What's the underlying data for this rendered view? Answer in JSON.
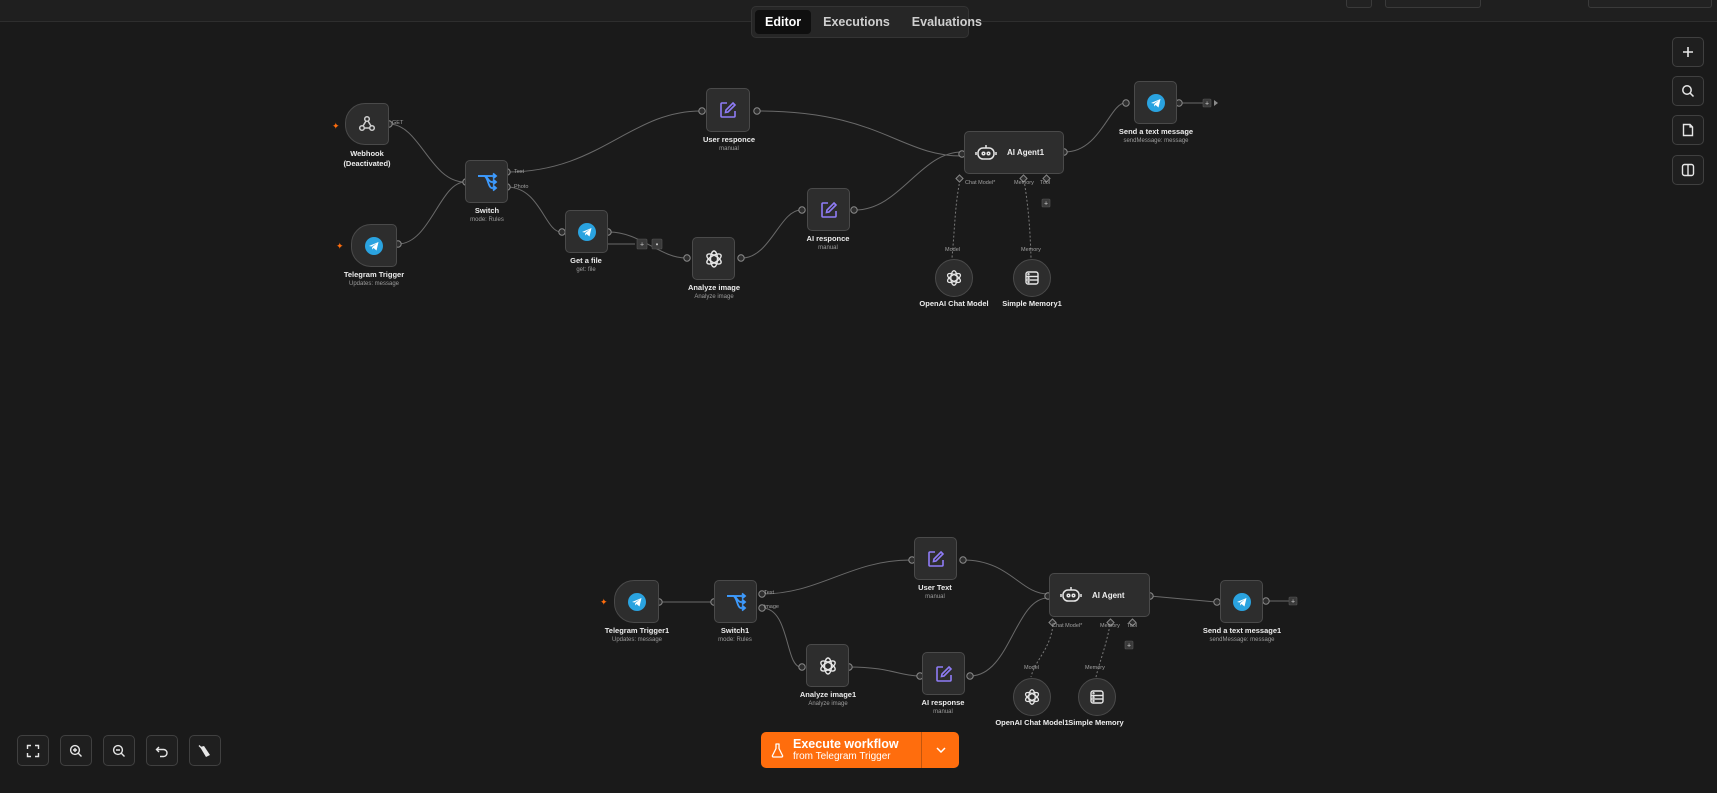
{
  "tabs": {
    "editor": "Editor",
    "executions": "Executions",
    "evaluations": "Evaluations",
    "active": "Editor"
  },
  "execute": {
    "label": "Execute workflow",
    "sub": "from Telegram Trigger"
  },
  "right_tools": [
    "plus-icon",
    "search-icon",
    "sticky-note-icon",
    "panel-toggle-icon"
  ],
  "bottom_tools": [
    "fit-view-icon",
    "zoom-in-icon",
    "zoom-out-icon",
    "undo-icon",
    "clear-execution-icon"
  ],
  "colors": {
    "accent": "#ff6d0d",
    "telegram": "#2aa3e0",
    "canvas": "#1a1a1a",
    "node": "#2d2d2d",
    "edit": "#8f7cf7",
    "switch": "#3d9bff"
  },
  "w1": {
    "webhook": {
      "name": "Webhook",
      "sub": "(Deactivated)",
      "out": "GET"
    },
    "tg": {
      "name": "Telegram Trigger",
      "sub": "Updates: message"
    },
    "sw": {
      "name": "Switch",
      "sub": "mode: Rules",
      "out1": "Text",
      "out2": "Photo"
    },
    "user": {
      "name": "User responce",
      "sub": "manual"
    },
    "getfile": {
      "name": "Get a file",
      "sub": "get: file"
    },
    "analyze": {
      "name": "Analyze image",
      "sub": "Analyze image"
    },
    "ai": {
      "name": "AI responce",
      "sub": "manual"
    },
    "agent": {
      "name": "AI Agent1",
      "p_model": "Chat Model*",
      "p_memory": "Memory",
      "p_tool": "Tool"
    },
    "send": {
      "name": "Send a text message",
      "sub": "sendMessage: message"
    },
    "openai": {
      "name": "OpenAI Chat Model",
      "port": "Model"
    },
    "memory": {
      "name": "Simple Memory1",
      "port": "Memory"
    }
  },
  "w2": {
    "tg": {
      "name": "Telegram Trigger1",
      "sub": "Updates: message"
    },
    "sw": {
      "name": "Switch1",
      "sub": "mode: Rules",
      "out1": "Text",
      "out2": "image"
    },
    "user": {
      "name": "User Text",
      "sub": "manual"
    },
    "analyze": {
      "name": "Analyze image1",
      "sub": "Analyze image"
    },
    "ai": {
      "name": "AI response",
      "sub": "manual"
    },
    "agent": {
      "name": "AI Agent",
      "p_model": "Chat Model*",
      "p_memory": "Memory",
      "p_tool": "Tool"
    },
    "send": {
      "name": "Send a text message1",
      "sub": "sendMessage: message"
    },
    "openai": {
      "name": "OpenAI Chat Model1",
      "port": "Model"
    },
    "memory": {
      "name": "Simple Memory",
      "port": "Memory"
    }
  }
}
